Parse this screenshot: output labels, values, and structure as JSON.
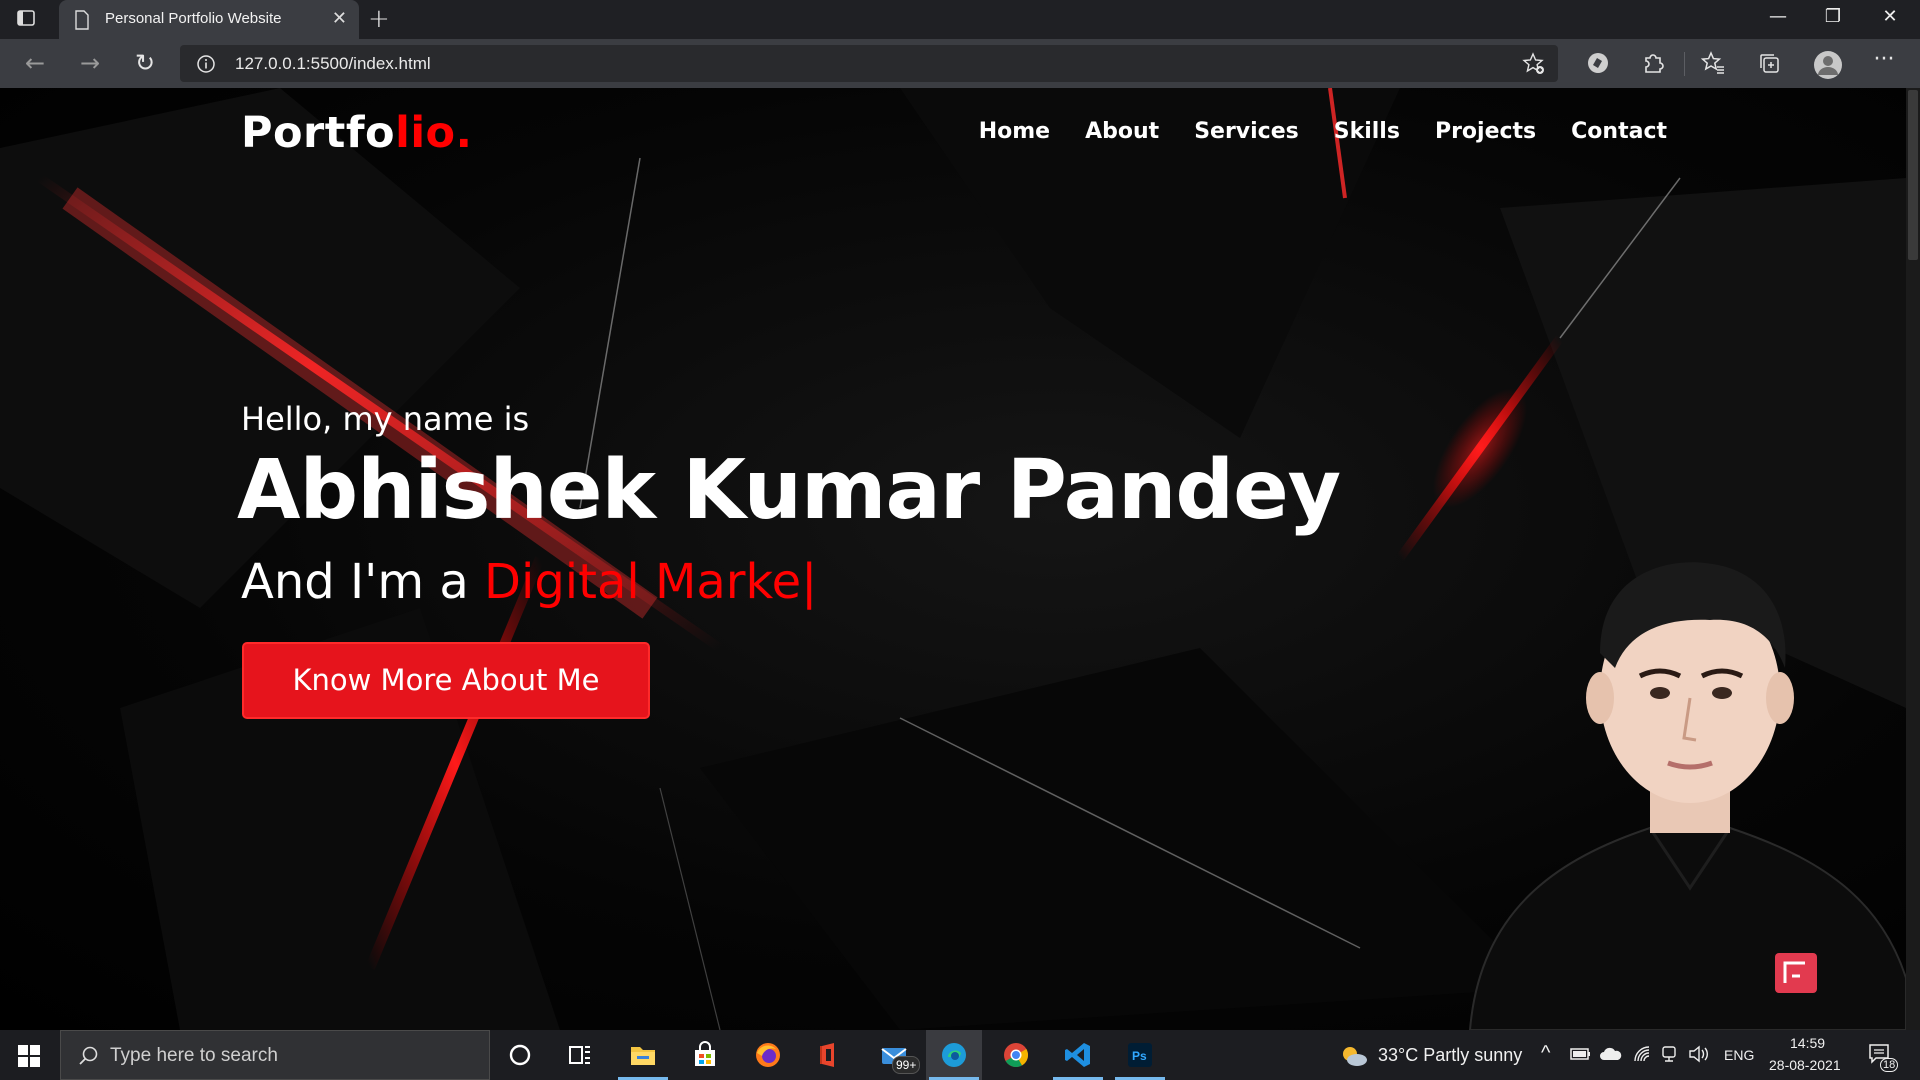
{
  "browser": {
    "tab_title": "Personal Portfolio Website",
    "url": "127.0.0.1:5500/index.html"
  },
  "page": {
    "logo_main": "Portfo",
    "logo_accent": "lio.",
    "nav": [
      "Home",
      "About",
      "Services",
      "Skills",
      "Projects",
      "Contact"
    ],
    "greeting": "Hello, my name is",
    "name": "Abhishek Kumar Pandey",
    "role_prefix": "And I'm a ",
    "role_typed": "Digital Marke",
    "cursor": "|",
    "cta_label": "Know More About Me",
    "accent_color": "#ff0000"
  },
  "taskbar": {
    "search_placeholder": "Type here to search",
    "mail_badge": "99+",
    "weather": "33°C  Partly sunny",
    "language": "ENG",
    "time": "14:59",
    "date": "28-08-2021",
    "notifications": "18"
  }
}
